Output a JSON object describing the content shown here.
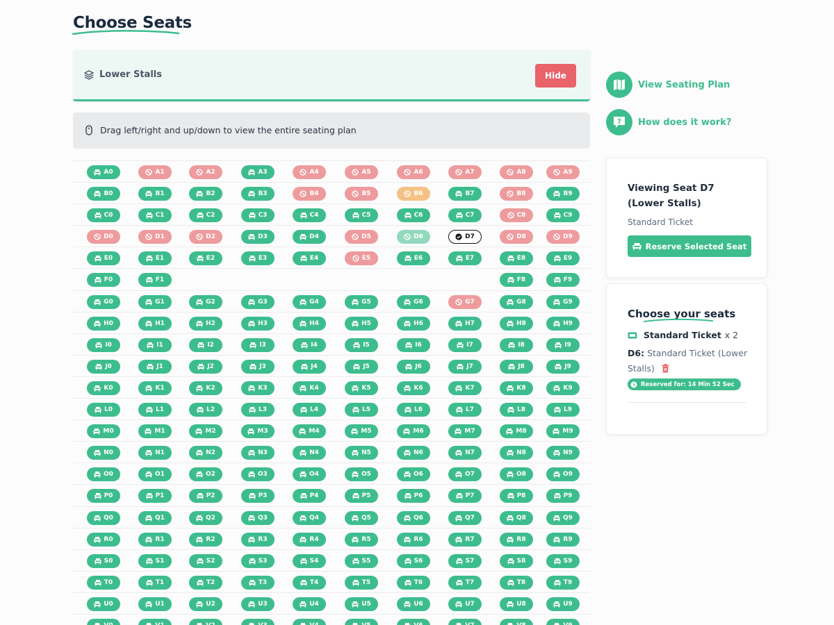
{
  "page": {
    "title": "Choose Seats"
  },
  "section": {
    "name": "Lower Stalls",
    "hide_label": "Hide"
  },
  "info": {
    "text": "Drag left/right and up/down to view the entire seating plan"
  },
  "colors": {
    "available": "#3dbd8e",
    "unavailable": "#ee9b9e",
    "held": "#f6c185",
    "reserved": "#93d9bf",
    "hide": "#e8636a"
  },
  "seat_grid": {
    "rows": [
      {
        "label": "A",
        "seats": [
          "available",
          "unavailable",
          "unavailable",
          "available",
          "unavailable",
          "unavailable",
          "unavailable",
          "unavailable",
          "unavailable",
          "unavailable"
        ]
      },
      {
        "label": "B",
        "seats": [
          "available",
          "available",
          "available",
          "available",
          "unavailable",
          "unavailable",
          "held",
          "available",
          "unavailable",
          "available"
        ]
      },
      {
        "label": "C",
        "seats": [
          "available",
          "available",
          "available",
          "available",
          "available",
          "available",
          "available",
          "available",
          "unavailable",
          "available"
        ]
      },
      {
        "label": "D",
        "seats": [
          "unavailable",
          "unavailable",
          "unavailable",
          "available",
          "available",
          "unavailable",
          "reserved",
          "selected",
          "unavailable",
          "unavailable"
        ]
      },
      {
        "label": "E",
        "seats": [
          "available",
          "available",
          "available",
          "available",
          "available",
          "unavailable",
          "available",
          "available",
          "available",
          "available"
        ]
      },
      {
        "label": "F",
        "seats": [
          "available",
          "available",
          null,
          null,
          null,
          null,
          null,
          null,
          "available",
          "available"
        ]
      },
      {
        "label": "G",
        "seats": [
          "available",
          "available",
          "available",
          "available",
          "available",
          "available",
          "available",
          "unavailable",
          "available",
          "available"
        ]
      },
      {
        "label": "H",
        "seats": [
          "available",
          "available",
          "available",
          "available",
          "available",
          "available",
          "available",
          "available",
          "available",
          "available"
        ]
      },
      {
        "label": "I",
        "seats": [
          "available",
          "available",
          "available",
          "available",
          "available",
          "available",
          "available",
          "available",
          "available",
          "available"
        ]
      },
      {
        "label": "J",
        "seats": [
          "available",
          "available",
          "available",
          "available",
          "available",
          "available",
          "available",
          "available",
          "available",
          "available"
        ]
      },
      {
        "label": "K",
        "seats": [
          "available",
          "available",
          "available",
          "available",
          "available",
          "available",
          "available",
          "available",
          "available",
          "available"
        ]
      },
      {
        "label": "L",
        "seats": [
          "available",
          "available",
          "available",
          "available",
          "available",
          "available",
          "available",
          "available",
          "available",
          "available"
        ]
      },
      {
        "label": "M",
        "seats": [
          "available",
          "available",
          "available",
          "available",
          "available",
          "available",
          "available",
          "available",
          "available",
          "available"
        ]
      },
      {
        "label": "N",
        "seats": [
          "available",
          "available",
          "available",
          "available",
          "available",
          "available",
          "available",
          "available",
          "available",
          "available"
        ]
      },
      {
        "label": "O",
        "seats": [
          "available",
          "available",
          "available",
          "available",
          "available",
          "available",
          "available",
          "available",
          "available",
          "available"
        ]
      },
      {
        "label": "P",
        "seats": [
          "available",
          "available",
          "available",
          "available",
          "available",
          "available",
          "available",
          "available",
          "available",
          "available"
        ]
      },
      {
        "label": "Q",
        "seats": [
          "available",
          "available",
          "available",
          "available",
          "available",
          "available",
          "available",
          "available",
          "available",
          "available"
        ]
      },
      {
        "label": "R",
        "seats": [
          "available",
          "available",
          "available",
          "available",
          "available",
          "available",
          "available",
          "available",
          "available",
          "available"
        ]
      },
      {
        "label": "S",
        "seats": [
          "available",
          "available",
          "available",
          "available",
          "available",
          "available",
          "available",
          "available",
          "available",
          "available"
        ]
      },
      {
        "label": "T",
        "seats": [
          "available",
          "available",
          "available",
          "available",
          "available",
          "available",
          "available",
          "available",
          "available",
          "available"
        ]
      },
      {
        "label": "U",
        "seats": [
          "available",
          "available",
          "available",
          "available",
          "available",
          "available",
          "available",
          "available",
          "available",
          "available"
        ]
      },
      {
        "label": "V",
        "seats": [
          "available",
          "available",
          "available",
          "available",
          "available",
          "available",
          "available",
          "available",
          "available",
          "available"
        ]
      }
    ]
  },
  "sidebar": {
    "links": [
      {
        "label": "View Seating Plan",
        "icon": "map-icon"
      },
      {
        "label": "How does it work?",
        "icon": "question-icon"
      }
    ],
    "viewing": {
      "title": "Viewing Seat D7 (Lower Stalls)",
      "ticket": "Standard Ticket",
      "reserve_label": "Reserve Selected Seat"
    },
    "basket": {
      "title": "Choose your seats",
      "ticket_name": "Standard Ticket",
      "ticket_qty": "x 2",
      "seat_code": "D6:",
      "seat_desc": "Standard Ticket (Lower Stalls)",
      "timer": "Reserved for: 14 Min 52 Sec"
    }
  }
}
